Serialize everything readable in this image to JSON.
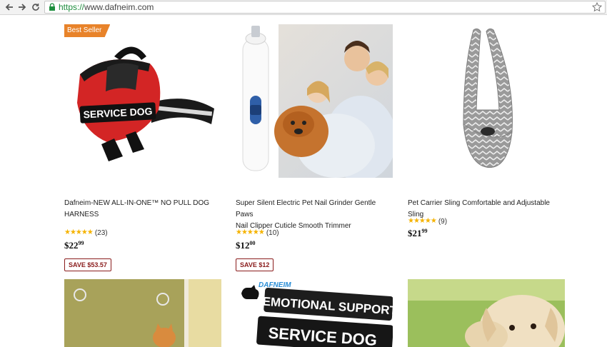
{
  "browser": {
    "url_scheme": "https://",
    "url_host": "www.dafneim.com"
  },
  "products": [
    {
      "badge": "Best Seller",
      "image_text": "SERVICE DOG",
      "title_line1": "Dafneim-NEW ALL-IN-ONE™ NO PULL DOG",
      "title_line2": "HARNESS",
      "stars": "★★★★★",
      "review_count": "(23)",
      "price_dollars": "$22",
      "price_cents": "99",
      "save_label": "SAVE $53.57"
    },
    {
      "title_line1": "Super Silent Electric Pet Nail Grinder Gentle Paws",
      "title_line2": "Nail Clipper Cuticle Smooth Trimmer",
      "stars": "★★★★★",
      "review_count": "(10)",
      "price_dollars": "$12",
      "price_cents": "00",
      "save_label": "SAVE $12"
    },
    {
      "title_line1": "Pet Carrier Sling Comfortable and Adjustable Sling",
      "stars": "★★★★★",
      "review_count": "(9)",
      "price_dollars": "$21",
      "price_cents": "99"
    }
  ],
  "row2": {
    "brand_text": "DAFNEIM",
    "patch_text_1": "EMOTIONAL SUPPORT",
    "patch_text_2": "SERVICE DOG"
  },
  "colors": {
    "badge": "#e8832a",
    "star": "#f5b301",
    "save_border": "#8a1c1c",
    "url_scheme": "#1e8e3e"
  }
}
